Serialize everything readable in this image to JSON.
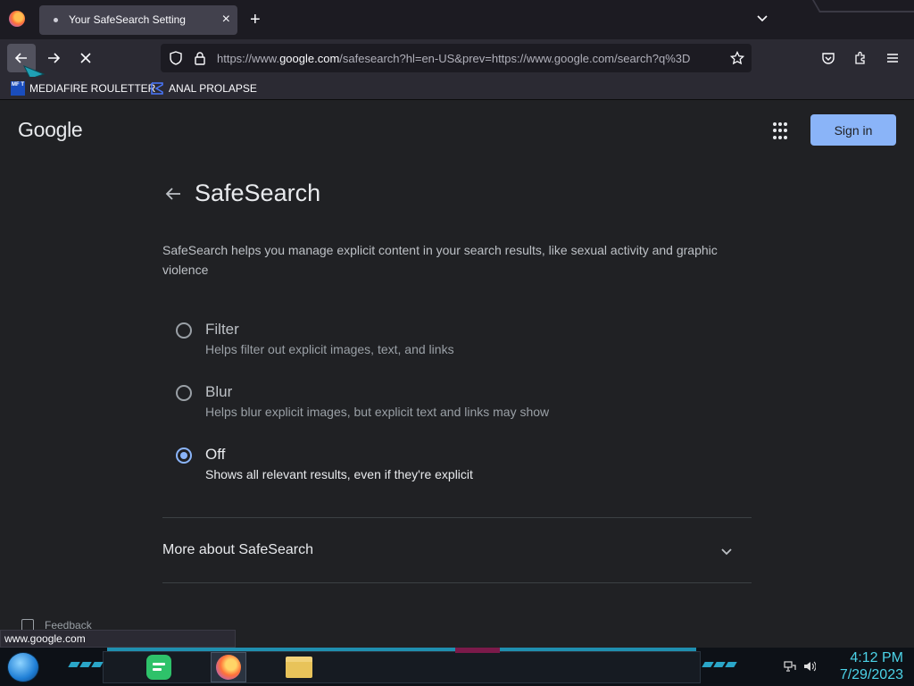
{
  "browser": {
    "tab_title": "Your SafeSearch Setting",
    "url_host_prefix": "https://www.",
    "url_host": "google.com",
    "url_path": "/safesearch?hl=en-US&prev=https://www.google.com/search?q%3D",
    "bookmarks": [
      {
        "label": "MEDIAFIRE ROULETTER",
        "icon": "mft-icon",
        "icon_text": "MF T"
      },
      {
        "label": "ANAL PROLAPSE",
        "icon": "sigma-icon"
      }
    ],
    "status_text": "www.google.com"
  },
  "google": {
    "logo": "Google",
    "signin_label": "Sign in"
  },
  "safesearch": {
    "title": "SafeSearch",
    "description": "SafeSearch helps you manage explicit content in your search results, like sexual activity and graphic violence",
    "options": [
      {
        "label": "Filter",
        "sub": "Helps filter out explicit images, text, and links",
        "checked": false
      },
      {
        "label": "Blur",
        "sub": "Helps blur explicit images, but explicit text and links may show",
        "checked": false
      },
      {
        "label": "Off",
        "sub": "Shows all relevant results, even if they're explicit",
        "checked": true
      }
    ],
    "more_label": "More about SafeSearch",
    "feedback_label": "Feedback"
  },
  "taskbar": {
    "time": "4:12 PM",
    "date": "7/29/2023"
  },
  "colors": {
    "accent": "#8ab4f8",
    "page_bg": "#202124",
    "clock": "#4cd3e8"
  }
}
